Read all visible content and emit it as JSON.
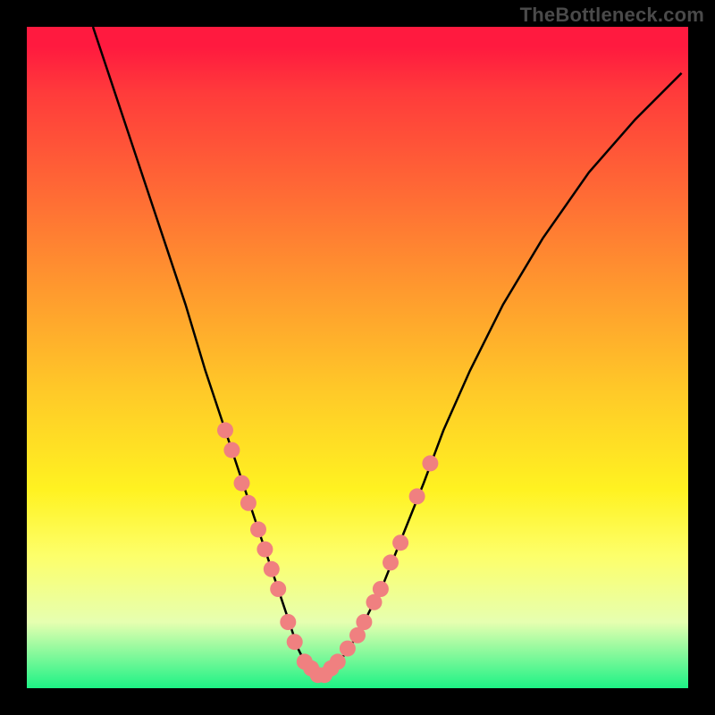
{
  "watermark": "TheBottleneck.com",
  "chart_data": {
    "type": "line",
    "title": "",
    "xlabel": "",
    "ylabel": "",
    "xlim": [
      0,
      100
    ],
    "ylim": [
      0,
      100
    ],
    "grid": false,
    "colors": {
      "gradient_top": "#ff1a3f",
      "gradient_bottom": "#1df285",
      "curve": "#000000",
      "markers": "#f08080",
      "background": "#000000"
    },
    "series": [
      {
        "name": "bottleneck-curve",
        "x": [
          10,
          12,
          15,
          18,
          21,
          24,
          27,
          30,
          33,
          35,
          37,
          39,
          40,
          41,
          42,
          43,
          44,
          45,
          46,
          48,
          50,
          52,
          54,
          56,
          58,
          60,
          63,
          67,
          72,
          78,
          85,
          92,
          99
        ],
        "y": [
          100,
          94,
          85,
          76,
          67,
          58,
          48,
          39,
          30,
          24,
          18,
          12,
          9,
          6,
          4,
          3,
          2,
          2,
          3,
          5,
          8,
          12,
          16,
          21,
          26,
          31,
          39,
          48,
          58,
          68,
          78,
          86,
          93
        ]
      }
    ],
    "markers": [
      {
        "x": 30.0,
        "y": 39
      },
      {
        "x": 31.0,
        "y": 36
      },
      {
        "x": 32.5,
        "y": 31
      },
      {
        "x": 33.5,
        "y": 28
      },
      {
        "x": 35.0,
        "y": 24
      },
      {
        "x": 36.0,
        "y": 21
      },
      {
        "x": 37.0,
        "y": 18
      },
      {
        "x": 38.0,
        "y": 15
      },
      {
        "x": 39.5,
        "y": 10
      },
      {
        "x": 40.5,
        "y": 7
      },
      {
        "x": 42.0,
        "y": 4
      },
      {
        "x": 43.0,
        "y": 3
      },
      {
        "x": 44.0,
        "y": 2
      },
      {
        "x": 45.0,
        "y": 2
      },
      {
        "x": 46.0,
        "y": 3
      },
      {
        "x": 47.0,
        "y": 4
      },
      {
        "x": 48.5,
        "y": 6
      },
      {
        "x": 50.0,
        "y": 8
      },
      {
        "x": 51.0,
        "y": 10
      },
      {
        "x": 52.5,
        "y": 13
      },
      {
        "x": 53.5,
        "y": 15
      },
      {
        "x": 55.0,
        "y": 19
      },
      {
        "x": 56.5,
        "y": 22
      },
      {
        "x": 59.0,
        "y": 29
      },
      {
        "x": 61.0,
        "y": 34
      }
    ]
  }
}
